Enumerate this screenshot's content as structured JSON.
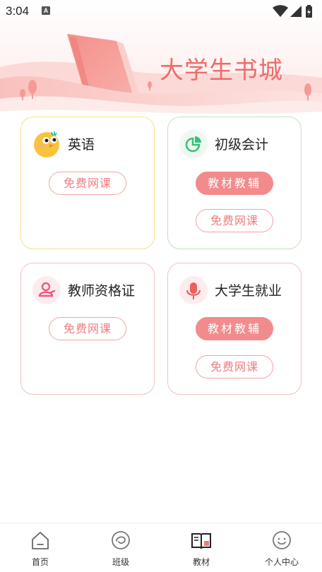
{
  "status_bar": {
    "time": "3:04",
    "notification_badge": "A",
    "icons": [
      "wifi-icon",
      "signal-icon",
      "battery-icon"
    ]
  },
  "banner": {
    "title": "大学生书城"
  },
  "cards": [
    {
      "title": "英语",
      "icon": "chick-icon",
      "buttons": [
        "免费网课"
      ]
    },
    {
      "title": "初级会计",
      "icon": "pie-chart-icon",
      "buttons": [
        "教材教辅",
        "免费网课"
      ]
    },
    {
      "title": "教师资格证",
      "icon": "teacher-icon",
      "buttons": [
        "免费网课"
      ]
    },
    {
      "title": "大学生就业",
      "icon": "microphone-icon",
      "buttons": [
        "教材教辅",
        "免费网课"
      ]
    }
  ],
  "bottom_nav": [
    {
      "label": "首页",
      "icon": "home-icon"
    },
    {
      "label": "班级",
      "icon": "class-icon"
    },
    {
      "label": "教材",
      "icon": "book-icon",
      "active": true
    },
    {
      "label": "个人中心",
      "icon": "profile-icon"
    }
  ],
  "colors": {
    "accent": "#ef6b6b",
    "button_fill": "#f28b8b",
    "english_border": "#f7df8e",
    "accounting_border": "#bfe3c4",
    "pink_border": "#f5c0c0"
  }
}
